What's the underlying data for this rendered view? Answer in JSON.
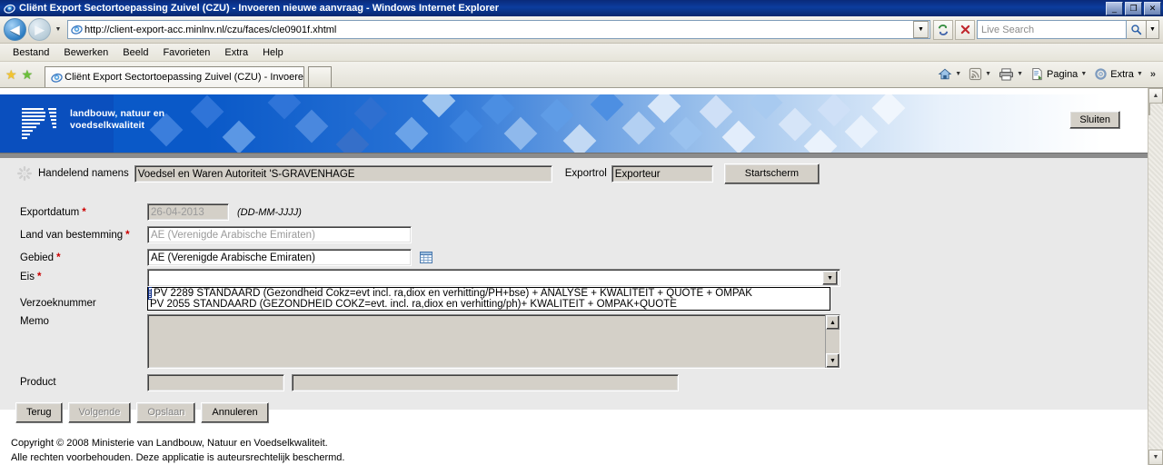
{
  "window": {
    "title": "Cliënt Export Sectortoepassing Zuivel (CZU) - Invoeren nieuwe aanvraag - Windows Internet Explorer",
    "minimize": "_",
    "maximize": "❐",
    "close": "✕"
  },
  "navbar": {
    "back_glyph": "◀",
    "forward_glyph": "▶",
    "history_caret": "▼",
    "url": "http://client-export-acc.minlnv.nl/czu/faces/cle0901f.xhtml",
    "url_dropdown_caret": "▼",
    "refresh_glyph": "↻",
    "stop_glyph": "✕",
    "search_placeholder": "Live Search",
    "search_value": "",
    "search_caret": "▼"
  },
  "menu": {
    "items": [
      {
        "label": "Bestand"
      },
      {
        "label": "Bewerken"
      },
      {
        "label": "Beeld"
      },
      {
        "label": "Favorieten"
      },
      {
        "label": "Extra"
      },
      {
        "label": "Help"
      }
    ]
  },
  "tabbar": {
    "favorites_star": "★",
    "add_favorite_star": "★",
    "tab_label": "Cliënt Export Sectortoepassing Zuivel (CZU) - Invoere…",
    "new_tab_label": "",
    "tools": [
      {
        "name": "home",
        "label": "",
        "caret": "▼"
      },
      {
        "name": "feeds",
        "label": "",
        "caret": "▼"
      },
      {
        "name": "print",
        "label": "",
        "caret": "▼"
      },
      {
        "name": "page",
        "label": "Pagina",
        "caret": "▼"
      },
      {
        "name": "tools",
        "label": "Extra",
        "caret": "▼"
      }
    ],
    "overflow": "»"
  },
  "banner": {
    "logo_line1": "landbouw, natuur en",
    "logo_line2": "voedselkwaliteit",
    "close_button": "Sluiten",
    "accent_color": "#0a59c8"
  },
  "context": {
    "acting_on_behalf_label": "Handelend namens",
    "acting_on_behalf_value": "Voedsel en Waren Autoriteit 'S-GRAVENHAGE",
    "export_role_label": "Exportrol",
    "export_role_value": "Exporteur",
    "home_button": "Startscherm"
  },
  "form": {
    "fields": [
      {
        "label": "Exportdatum",
        "required": "*",
        "value": "26-04-2013",
        "hint": "(DD-MM-JJJJ)"
      },
      {
        "label": "Land van bestemming",
        "required": "*",
        "value": "AE (Verenigde Arabische Emiraten)",
        "hint": ""
      },
      {
        "label": "Gebied",
        "required": "*",
        "value": "AE (Verenigde Arabische Emiraten)",
        "hint": ""
      }
    ],
    "eis": {
      "label": "Eis",
      "required": "*",
      "value": "",
      "dropdown_caret": "▼",
      "options": [
        "",
        "PV 2289 STANDAARD (Gezondheid Cokz=evt incl. ra,diox en verhitting/PH+bse) + ANALYSE + KWALITEIT + QUOTE + OMPAK",
        "PV 2055 STANDAARD (GEZONDHEID COKZ=evt. incl. ra,diox en verhitting/ph)+ KWALITEIT + OMPAK+QUOTE"
      ],
      "selected_index": 0
    },
    "verzoeknummer": {
      "label": "Verzoeknummer",
      "value": ""
    },
    "memo": {
      "label": "Memo",
      "value": ""
    },
    "product": {
      "label": "Product",
      "code_value": "",
      "desc_value": ""
    }
  },
  "buttons": [
    {
      "label": "Terug",
      "disabled": false
    },
    {
      "label": "Volgende",
      "disabled": true
    },
    {
      "label": "Opslaan",
      "disabled": true
    },
    {
      "label": "Annuleren",
      "disabled": false
    }
  ],
  "footer": {
    "line1": "Copyright © 2008 Ministerie van Landbouw, Natuur en Voedselkwaliteit.",
    "line2": "Alle rechten voorbehouden. Deze applicatie is auteursrechtelijk beschermd."
  },
  "scrollbar": {
    "up": "▲",
    "down": "▼"
  }
}
